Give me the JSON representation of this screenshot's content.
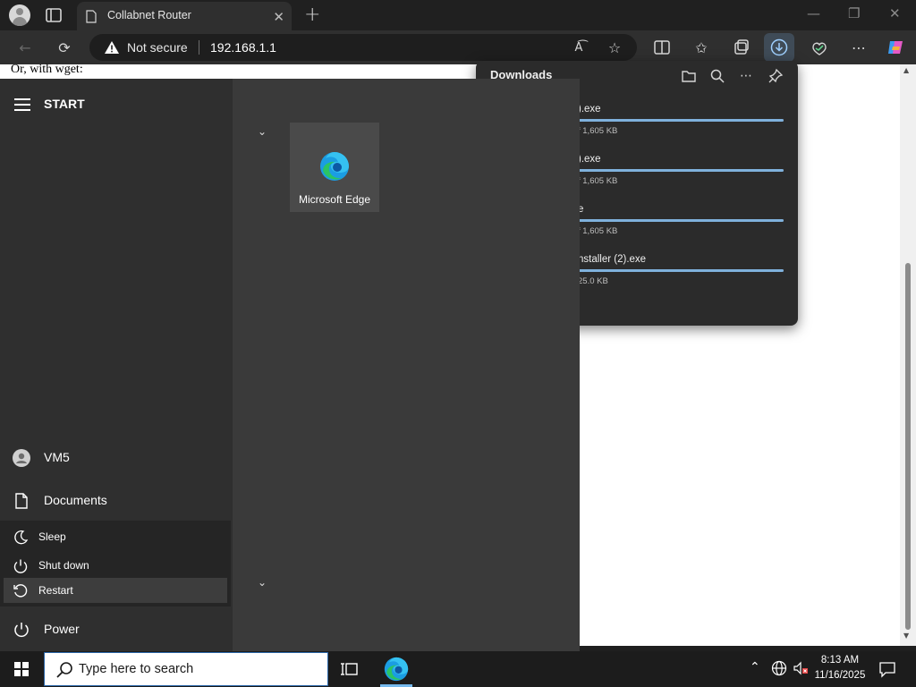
{
  "browser": {
    "tab_title": "Collabnet Router",
    "security_label": "Not secure",
    "url": "192.168.1.1"
  },
  "page": {
    "text": "Or, with wget:"
  },
  "downloads": {
    "title": "Downloads",
    "items": [
      {
        "name": ").exe",
        "size": "f 1,605 KB",
        "progress": 1.0
      },
      {
        "name": ").exe",
        "size": "f 1,605 KB",
        "progress": 1.0
      },
      {
        "name": "e",
        "size": "f 1,605 KB",
        "progress": 1.0
      },
      {
        "name": "nstaller (2).exe",
        "size": "25.0 KB",
        "progress": 1.0
      }
    ]
  },
  "start_menu": {
    "label": "START",
    "tile_label": "Microsoft Edge",
    "user": "VM5",
    "documents": "Documents",
    "power": "Power",
    "power_options": {
      "sleep": "Sleep",
      "shutdown": "Shut down",
      "restart": "Restart"
    }
  },
  "taskbar": {
    "search_placeholder": "Type here to search",
    "time": "8:13 AM",
    "date": "11/16/2025"
  },
  "colors": {
    "accent": "#76b9ed",
    "progress": "#7fb1dc",
    "start_bg": "#3a3a3a",
    "taskbar_bg": "#1c1c1c"
  }
}
